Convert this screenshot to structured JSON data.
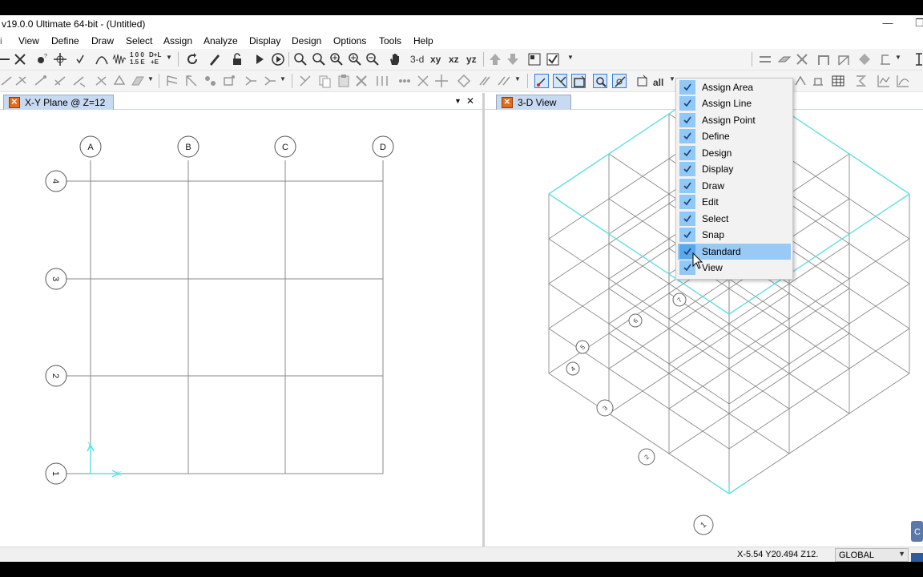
{
  "window": {
    "title": "v19.0.0 Ultimate 64-bit - (Untitled)",
    "minimize_glyph": "—",
    "restore_glyph": "❐"
  },
  "menu": [
    "View",
    "Define",
    "Draw",
    "Select",
    "Assign",
    "Analyze",
    "Display",
    "Design",
    "Options",
    "Tools",
    "Help"
  ],
  "toolbar": {
    "view_3d": "3-d",
    "view_xy": "xy",
    "view_xz": "xz",
    "view_yz": "yz",
    "frames_100": "1 0 0",
    "frames_15e": "1.5 E",
    "frames_dl": "D+L",
    "frames_e": "+E",
    "select_all": "all"
  },
  "left_pane": {
    "tab_label": "X-Y Plane @ Z=12",
    "dropdown_glyph": "▼",
    "close_glyph": "✕",
    "grid_columns": [
      "A",
      "B",
      "C",
      "D"
    ],
    "grid_rows": [
      "4",
      "3",
      "2",
      "1"
    ],
    "axis_x": "X",
    "axis_y": "Y"
  },
  "right_pane": {
    "tab_label": "3-D View",
    "bubble_labels": [
      "1",
      "2",
      "3",
      "4",
      "5",
      "6",
      "7"
    ]
  },
  "context_menu": {
    "items": [
      {
        "label": "Assign Area",
        "checked": true
      },
      {
        "label": "Assign Line",
        "checked": true
      },
      {
        "label": "Assign Point",
        "checked": true
      },
      {
        "label": "Define",
        "checked": true
      },
      {
        "label": "Design",
        "checked": true
      },
      {
        "label": "Display",
        "checked": true
      },
      {
        "label": "Draw",
        "checked": true
      },
      {
        "label": "Edit",
        "checked": true
      },
      {
        "label": "Select",
        "checked": true
      },
      {
        "label": "Snap",
        "checked": true
      },
      {
        "label": "Standard",
        "checked": true,
        "highlighted": true
      },
      {
        "label": "View",
        "checked": true
      }
    ]
  },
  "status": {
    "coordinates": "X-5.54  Y20.494  Z12.",
    "coord_system": "GLOBAL"
  },
  "colors": {
    "highlight": "#99c9f5",
    "check_bg": "#90c8f6",
    "grid_line": "#8a8a8a",
    "axis_cyan": "#62e0e6",
    "tab_active": "#c8daf2"
  }
}
